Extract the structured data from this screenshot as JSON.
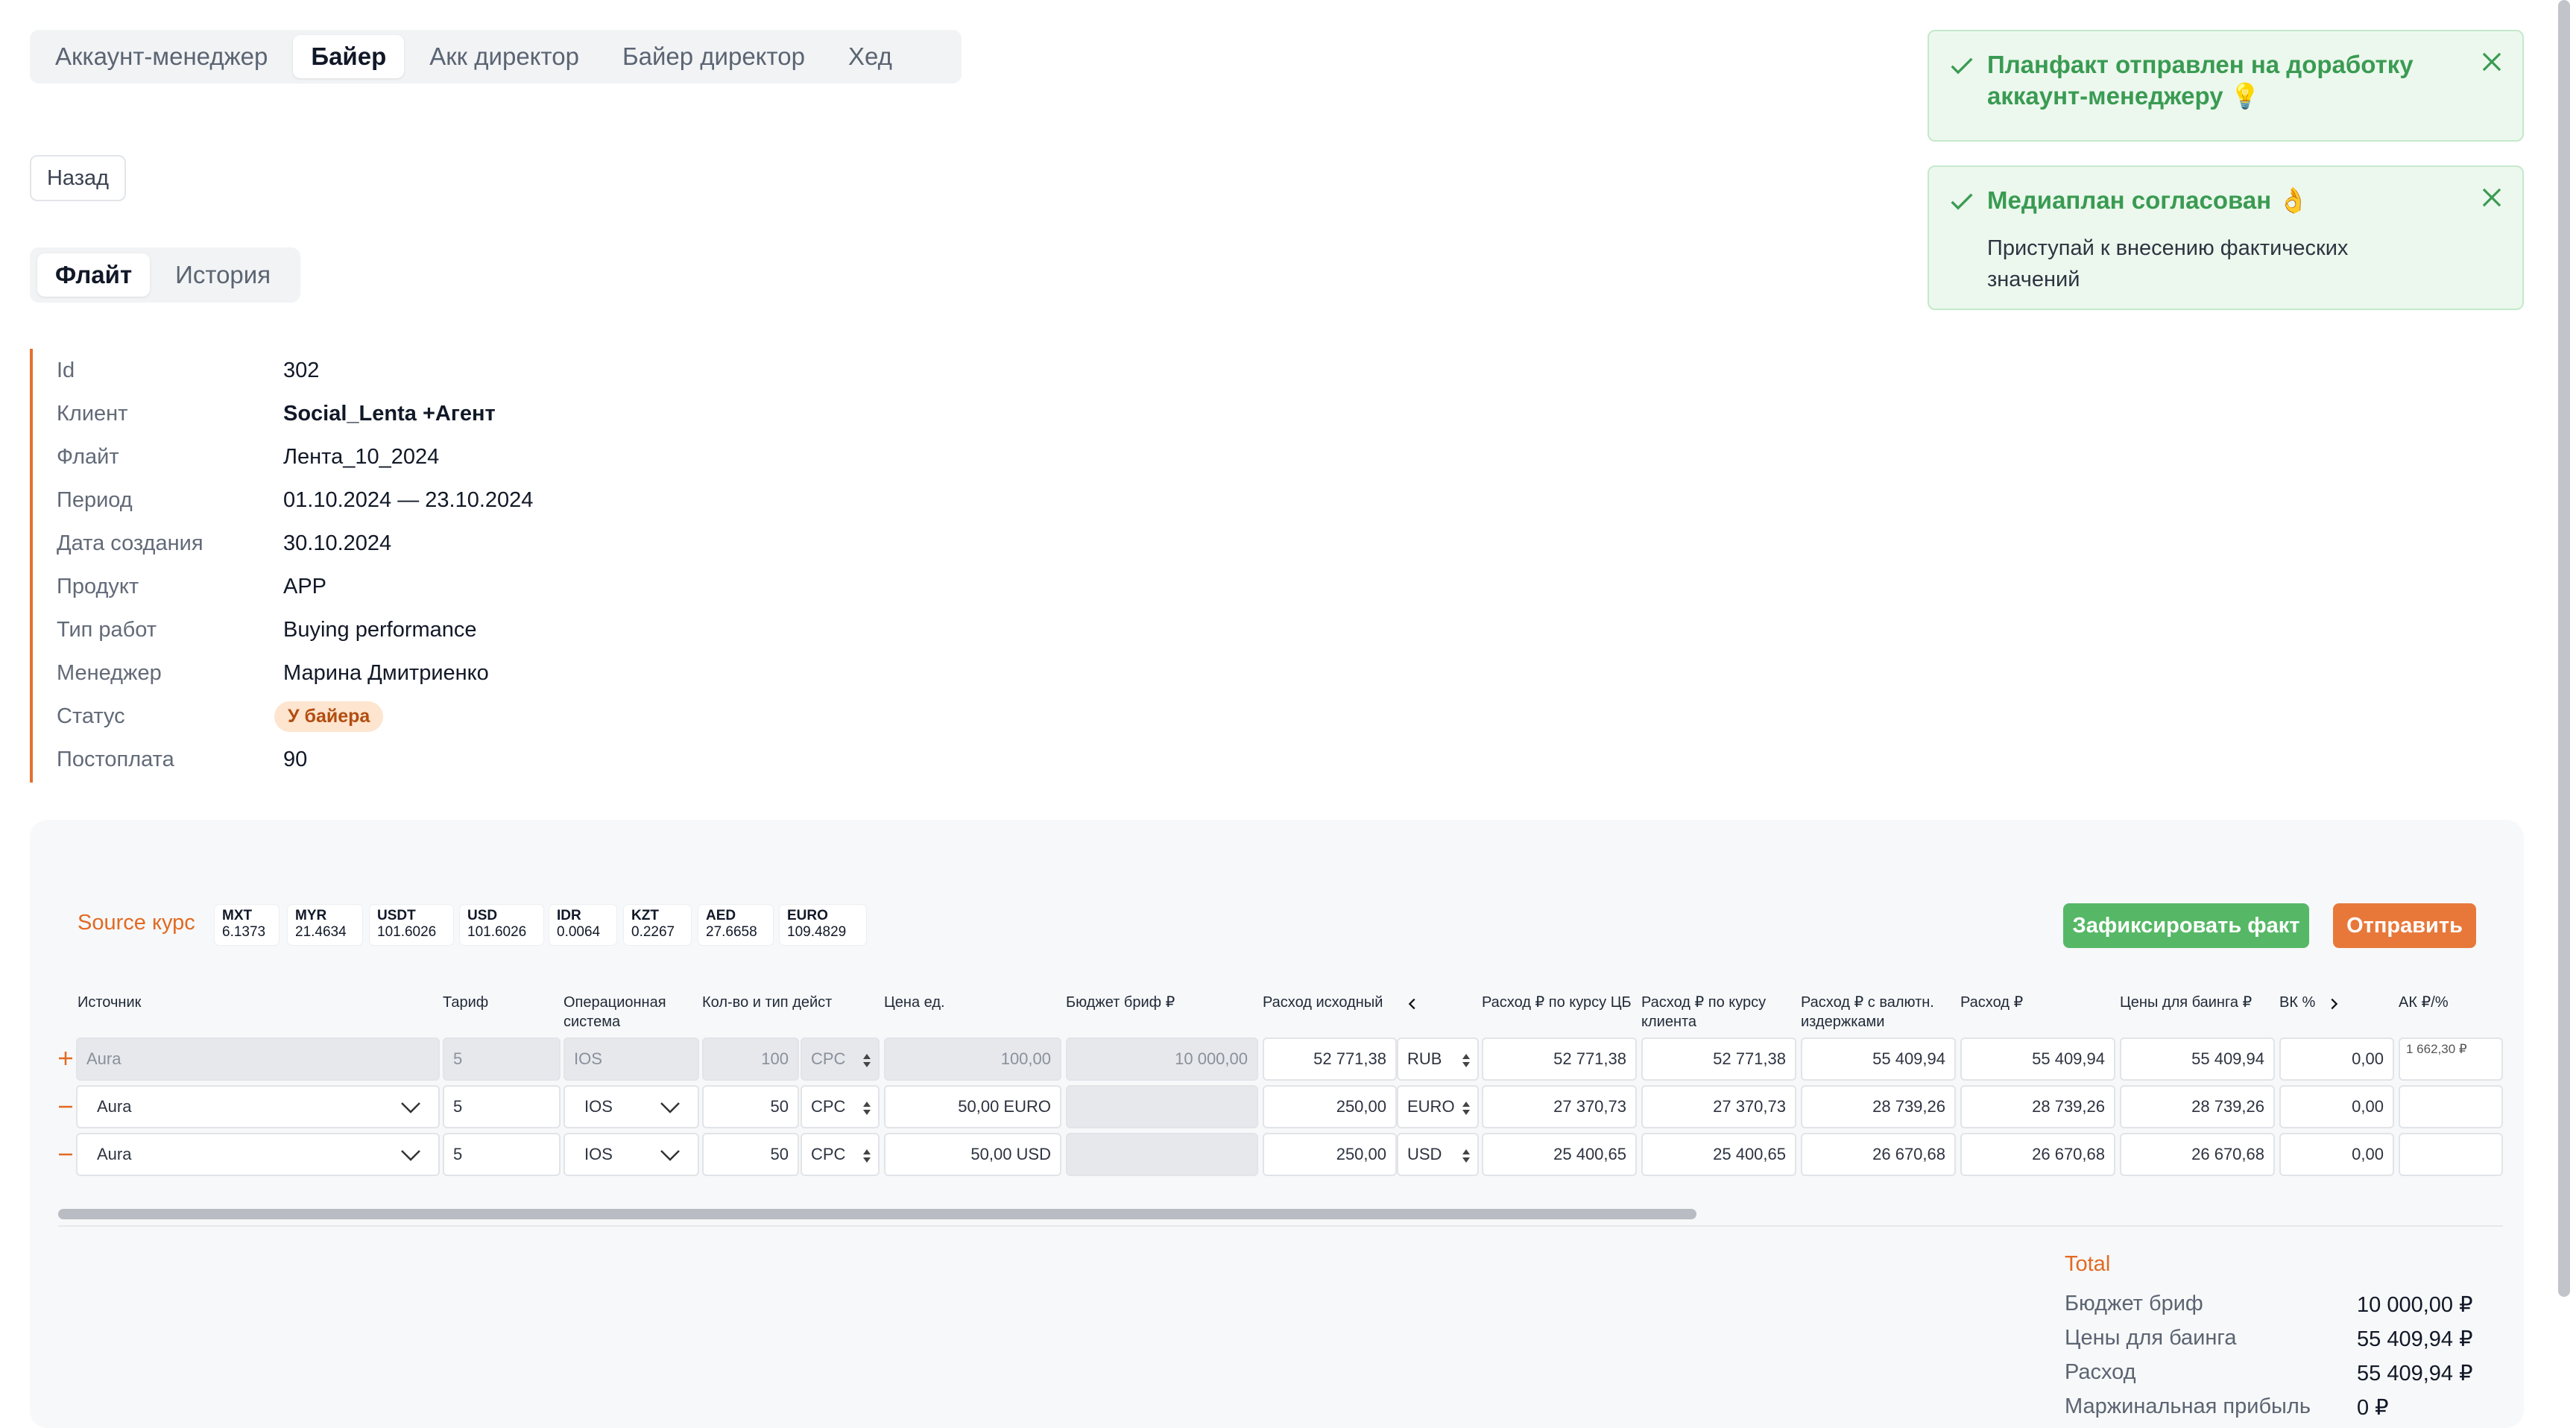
{
  "role_tabs": [
    "Аккаунт-менеджер",
    "Байер",
    "Акк директор",
    "Байер директор",
    "Хед"
  ],
  "active_role": "Байер",
  "back_label": "Назад",
  "flight_tabs": [
    "Флайт",
    "История"
  ],
  "info": {
    "id_label": "Id",
    "id": "302",
    "client_label": "Клиент",
    "client": "Social_Lenta +Агент",
    "flight_label": "Флайт",
    "flight": "Лента_10_2024",
    "period_label": "Период",
    "period": "01.10.2024 — 23.10.2024",
    "created_label": "Дата создания",
    "created": "30.10.2024",
    "product_label": "Продукт",
    "product": "APP",
    "work_type_label": "Тип работ",
    "work_type": "Buying performance",
    "manager_label": "Менеджер",
    "manager": "Марина Дмитриенко",
    "status_label": "Статус",
    "status": "У байера",
    "postpay_label": "Постоплата",
    "postpay": "90"
  },
  "toasts": [
    {
      "title": "Планфакт отправлен на доработку аккаунт-менеджеру 💡",
      "text": ""
    },
    {
      "title": "Медиаплан согласован 👌",
      "text": "Приступай к внесению фактических значений"
    }
  ],
  "source_label": "Source курс",
  "rates": [
    {
      "code": "MXT",
      "value": "6.1373"
    },
    {
      "code": "MYR",
      "value": "21.4634"
    },
    {
      "code": "USDT",
      "value": "101.6026"
    },
    {
      "code": "USD",
      "value": "101.6026"
    },
    {
      "code": "IDR",
      "value": "0.0064"
    },
    {
      "code": "KZT",
      "value": "0.2267"
    },
    {
      "code": "AED",
      "value": "27.6658"
    },
    {
      "code": "EURO",
      "value": "109.4829"
    }
  ],
  "buttons": {
    "fix": "Зафиксировать факт",
    "send": "Отправить"
  },
  "columns": {
    "source": "Источник",
    "tariff": "Тариф",
    "os": "Операционная система",
    "qty": "Кол-во и тип дейст",
    "unit_price": "Цена ед.",
    "brief_budget": "Бюджет бриф ₽",
    "orig_spend": "Расход исходный",
    "spend_cb": "Расход ₽ по курсу ЦБ",
    "spend_client": "Расход ₽ по курсу клиента",
    "spend_costs": "Расход ₽ с валютн. издержками",
    "spend": "Расход ₽",
    "buying_price": "Цены для баинга ₽",
    "bk": "ВК %",
    "ak": "АК ₽/%"
  },
  "rows": [
    {
      "sign": "+",
      "source": "Aura",
      "tariff": "5",
      "os": "IOS",
      "qty": "100",
      "qty_type": "CPC",
      "unit_price": "100,00",
      "brief_budget": "10 000,00",
      "orig_spend": "52 771,38",
      "currency": "RUB",
      "spend_cb": "52 771,38",
      "spend_client": "52 771,38",
      "spend_costs": "55 409,94",
      "spend": "55 409,94",
      "buying_price": "55 409,94",
      "bk": "0,00",
      "ak": "1 662,30 ₽"
    },
    {
      "sign": "−",
      "source": "Aura",
      "tariff": "5",
      "os": "IOS",
      "qty": "50",
      "qty_type": "CPC",
      "unit_price": "50,00 EURO",
      "brief_budget": "",
      "orig_spend": "250,00",
      "currency": "EURO",
      "spend_cb": "27 370,73",
      "spend_client": "27 370,73",
      "spend_costs": "28 739,26",
      "spend": "28 739,26",
      "buying_price": "28 739,26",
      "bk": "0,00",
      "ak": ""
    },
    {
      "sign": "−",
      "source": "Aura",
      "tariff": "5",
      "os": "IOS",
      "qty": "50",
      "qty_type": "CPC",
      "unit_price": "50,00 USD",
      "brief_budget": "",
      "orig_spend": "250,00",
      "currency": "USD",
      "spend_cb": "25 400,65",
      "spend_client": "25 400,65",
      "spend_costs": "26 670,68",
      "spend": "26 670,68",
      "buying_price": "26 670,68",
      "bk": "0,00",
      "ak": ""
    }
  ],
  "horizontal_scroll_fraction": 0.67,
  "total": {
    "title": "Total",
    "items": [
      {
        "label": "Бюджет бриф",
        "value": "10 000,00 ₽"
      },
      {
        "label": "Цены для баинга",
        "value": "55 409,94 ₽"
      },
      {
        "label": "Расход",
        "value": "55 409,94 ₽"
      },
      {
        "label": "Маржинальная прибыль",
        "value": "0 ₽"
      }
    ]
  },
  "colors": {
    "accent": "#e5702e",
    "success": "#56b866",
    "success_text": "#3a9b52",
    "status_bg": "#fde5cf"
  }
}
